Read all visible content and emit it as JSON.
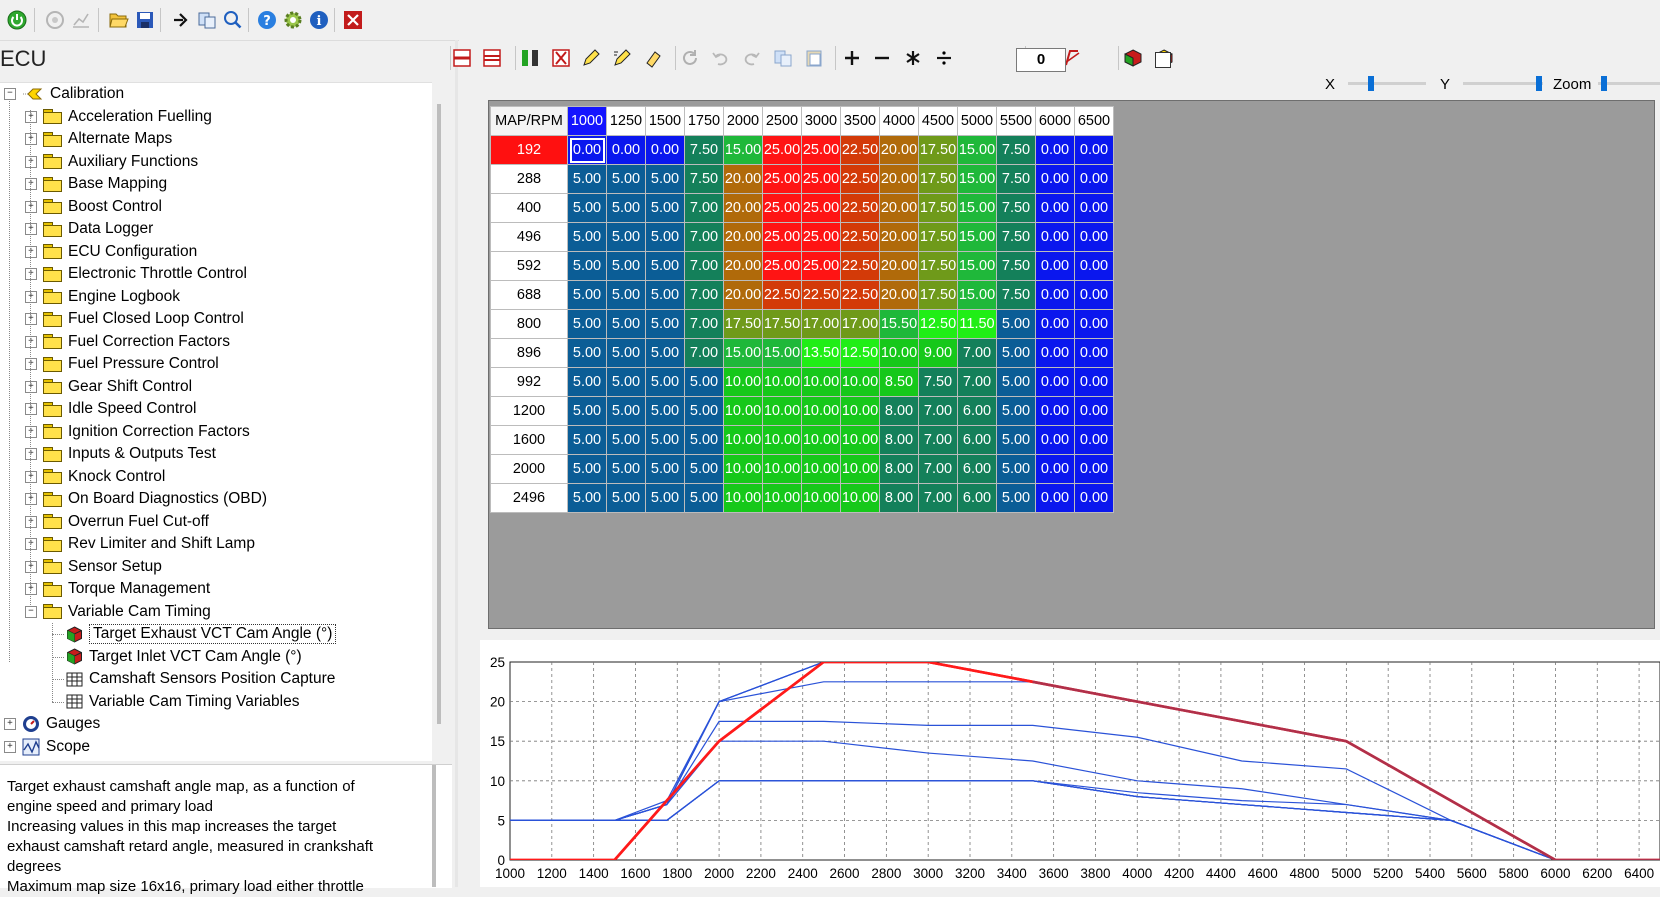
{
  "toolbar": {
    "icons": [
      "power-icon",
      "gauge-disabled-icon",
      "chart-disabled-icon",
      "open-folder-icon",
      "save-icon",
      "arrow-right-icon",
      "copy-icon",
      "search-icon",
      "help-icon",
      "gear-icon",
      "info-icon",
      "close-icon"
    ]
  },
  "ecu_title": "ECU",
  "tree": {
    "root": "Calibration",
    "folders": [
      "Acceleration Fuelling",
      "Alternate Maps",
      "Auxiliary Functions",
      "Base Mapping",
      "Boost Control",
      "Data Logger",
      "ECU Configuration",
      "Electronic Throttle Control",
      "Engine Logbook",
      "Fuel Closed Loop Control",
      "Fuel Correction Factors",
      "Fuel Pressure Control",
      "Gear Shift Control",
      "Idle Speed Control",
      "Ignition Correction Factors",
      "Inputs & Outputs Test",
      "Knock Control",
      "On Board Diagnostics (OBD)",
      "Overrun Fuel Cut-off",
      "Rev Limiter and Shift Lamp",
      "Sensor Setup",
      "Torque Management",
      "Variable Cam Timing"
    ],
    "vct_children": [
      "Target Exhaust VCT Cam Angle (°)",
      "Target Inlet VCT Cam Angle (°)",
      "Camshaft Sensors Position Capture",
      "Variable Cam Timing Variables"
    ],
    "bottom": [
      "Gauges",
      "Scope"
    ]
  },
  "description": "Target exhaust camshaft angle map, as a function of\nengine speed and primary load\nIncreasing values in this map increases the target\nexhaust camshaft retard angle, measured in crankshaft\ndegrees\nMaximum map size 16x16, primary load either throttle",
  "map_toolbar": {
    "constant_value": "0",
    "x_label": "X",
    "y_label": "Y",
    "zoom_label": "Zoom",
    "x_slider_level": 0.3,
    "y_slider_level": 0.95,
    "zoom_slider_level": 0.05
  },
  "map": {
    "corner": "MAP/RPM",
    "x_axis": [
      "1000",
      "1250",
      "1500",
      "1750",
      "2000",
      "2500",
      "3000",
      "3500",
      "4000",
      "4500",
      "5000",
      "5500",
      "6000",
      "6500"
    ],
    "y_axis": [
      "192",
      "288",
      "400",
      "496",
      "592",
      "688",
      "800",
      "896",
      "992",
      "1200",
      "1600",
      "2000",
      "2496"
    ],
    "selected_row": 0,
    "selected_col": 0,
    "rows": [
      [
        "0.00",
        "0.00",
        "0.00",
        "7.50",
        "15.00",
        "25.00",
        "25.00",
        "22.50",
        "20.00",
        "17.50",
        "15.00",
        "7.50",
        "0.00",
        "0.00"
      ],
      [
        "5.00",
        "5.00",
        "5.00",
        "7.50",
        "20.00",
        "25.00",
        "25.00",
        "22.50",
        "20.00",
        "17.50",
        "15.00",
        "7.50",
        "0.00",
        "0.00"
      ],
      [
        "5.00",
        "5.00",
        "5.00",
        "7.00",
        "20.00",
        "25.00",
        "25.00",
        "22.50",
        "20.00",
        "17.50",
        "15.00",
        "7.50",
        "0.00",
        "0.00"
      ],
      [
        "5.00",
        "5.00",
        "5.00",
        "7.00",
        "20.00",
        "25.00",
        "25.00",
        "22.50",
        "20.00",
        "17.50",
        "15.00",
        "7.50",
        "0.00",
        "0.00"
      ],
      [
        "5.00",
        "5.00",
        "5.00",
        "7.00",
        "20.00",
        "25.00",
        "25.00",
        "22.50",
        "20.00",
        "17.50",
        "15.00",
        "7.50",
        "0.00",
        "0.00"
      ],
      [
        "5.00",
        "5.00",
        "5.00",
        "7.00",
        "20.00",
        "22.50",
        "22.50",
        "22.50",
        "20.00",
        "17.50",
        "15.00",
        "7.50",
        "0.00",
        "0.00"
      ],
      [
        "5.00",
        "5.00",
        "5.00",
        "7.00",
        "17.50",
        "17.50",
        "17.00",
        "17.00",
        "15.50",
        "12.50",
        "11.50",
        "5.00",
        "0.00",
        "0.00"
      ],
      [
        "5.00",
        "5.00",
        "5.00",
        "7.00",
        "15.00",
        "15.00",
        "13.50",
        "12.50",
        "10.00",
        "9.00",
        "7.00",
        "5.00",
        "0.00",
        "0.00"
      ],
      [
        "5.00",
        "5.00",
        "5.00",
        "5.00",
        "10.00",
        "10.00",
        "10.00",
        "10.00",
        "8.50",
        "7.50",
        "7.00",
        "5.00",
        "0.00",
        "0.00"
      ],
      [
        "5.00",
        "5.00",
        "5.00",
        "5.00",
        "10.00",
        "10.00",
        "10.00",
        "10.00",
        "8.00",
        "7.00",
        "6.00",
        "5.00",
        "0.00",
        "0.00"
      ],
      [
        "5.00",
        "5.00",
        "5.00",
        "5.00",
        "10.00",
        "10.00",
        "10.00",
        "10.00",
        "8.00",
        "7.00",
        "6.00",
        "5.00",
        "0.00",
        "0.00"
      ],
      [
        "5.00",
        "5.00",
        "5.00",
        "5.00",
        "10.00",
        "10.00",
        "10.00",
        "10.00",
        "8.00",
        "7.00",
        "6.00",
        "5.00",
        "0.00",
        "0.00"
      ],
      [
        "5.00",
        "5.00",
        "5.00",
        "5.00",
        "10.00",
        "10.00",
        "10.00",
        "10.00",
        "8.00",
        "7.00",
        "6.00",
        "5.00",
        "0.00",
        "0.00"
      ]
    ]
  },
  "colors": {
    "selected_header_x": "#1414ff",
    "selected_header_y": "#ff1010",
    "chart_series": "#2a52d8",
    "chart_highlight": "#ff1a1a",
    "chart_highlight2": "#b0304a"
  },
  "chart_data": {
    "type": "line",
    "x": [
      1000,
      1250,
      1500,
      1750,
      2000,
      2500,
      3000,
      3500,
      4000,
      4500,
      5000,
      5500,
      6000,
      6500
    ],
    "x_ticks": [
      "1000",
      "1200",
      "1400",
      "1600",
      "1800",
      "2000",
      "2200",
      "2400",
      "2600",
      "2800",
      "3000",
      "3200",
      "3400",
      "3600",
      "3800",
      "4000",
      "4200",
      "4400",
      "4600",
      "4800",
      "5000",
      "5200",
      "5400",
      "5600",
      "5800",
      "6000",
      "6200",
      "6400"
    ],
    "y_ticks": [
      "0",
      "5",
      "10",
      "15",
      "20",
      "25"
    ],
    "xlim": [
      1000,
      6500
    ],
    "ylim": [
      0,
      25
    ],
    "grid": true,
    "highlight_row": 0
  }
}
